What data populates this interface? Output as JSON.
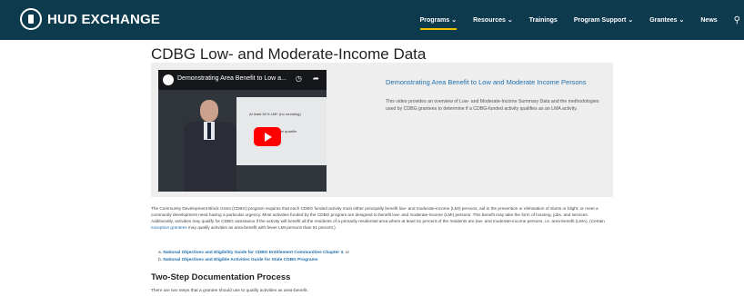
{
  "header": {
    "brand": "HUD EXCHANGE",
    "nav": [
      "Programs ⌄",
      "Resources ⌄",
      "Trainings",
      "Program Support ⌄",
      "Grantees ⌄",
      "News"
    ]
  },
  "page": {
    "title": "CDBG Low- and Moderate-Income Data"
  },
  "video": {
    "title": "Demonstrating Area Benefit to Low a...",
    "slide_line1": "At least 51% LMI* (no rounding)",
    "slide_line2": "for upper quartile",
    "heading": "Demonstrating Area Benefit to Low and Moderate Income Persons",
    "description": "This video provides an overview of Low- and Moderate-Income Summary Data and the methodologies used by CDBG grantees to determine if a CDBG-funded activity qualifies as an LMA activity."
  },
  "intro": {
    "text_before": "The Community Development Block Grant (CDBG) program requires that each CDBG funded activity must either principally benefit low- and moderate-income (LMI) persons, aid in the prevention or elimination of slums or blight, or meet a community development need having a particular urgency. Most activities funded by the CDBG program are designed to benefit low- and moderate-income (LMI) persons. This benefit may take the form of housing, jobs, and services. Additionally, activities may qualify for CDBG assistance if the activity will benefit all the residents of a primarily residential area where at least 51 percent of the residents are low- and moderate-income persons, i.e. area-benefit (LMA). (Certain ",
    "link": "exception grantees",
    "text_after": " may qualify activities as area-benefit with fewer LMI persons than 51 percent.)"
  },
  "links": [
    {
      "prefix": "a.",
      "label": "National Objectives and Eligibility Guide for CDBG Entitlement Communities Chapter 3",
      "suffix": ", or"
    },
    {
      "prefix": "b.",
      "label": "National Objectives and Eligible Activities Guide for State CDBG Programs",
      "suffix": ""
    }
  ],
  "section": {
    "title": "Two-Step Documentation Process",
    "body": "There are two steps that a grantee should use to qualify activities as area-benefit."
  }
}
